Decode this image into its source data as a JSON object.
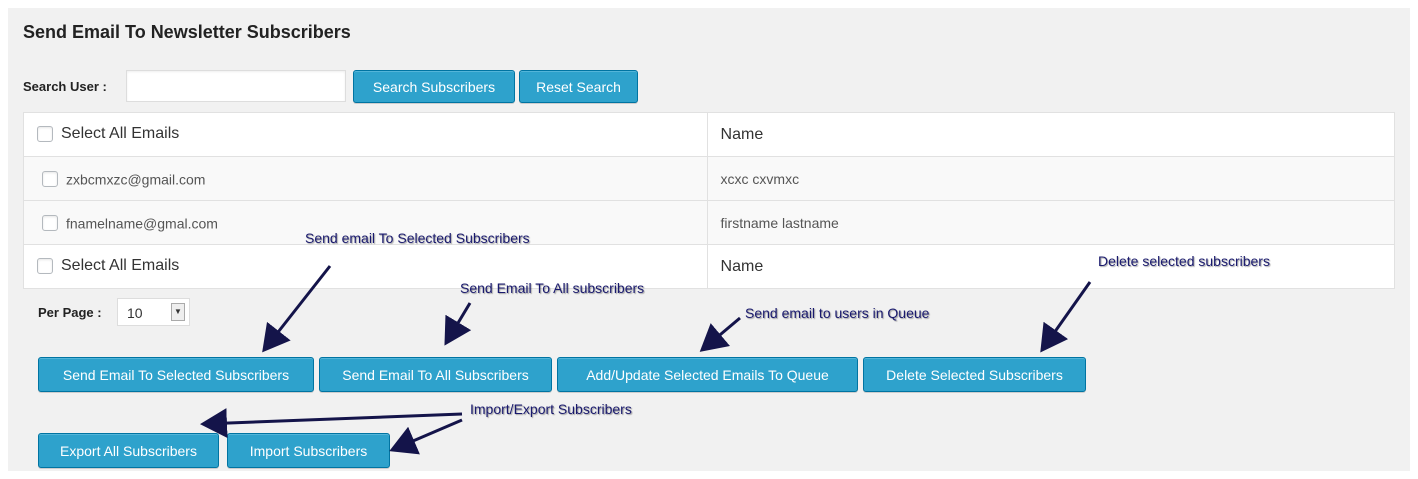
{
  "page": {
    "title": "Send Email To Newsletter Subscribers"
  },
  "search": {
    "label": "Search User :",
    "value": "",
    "placeholder": "",
    "search_button": "Search Subscribers",
    "reset_button": "Reset Search"
  },
  "table": {
    "header": {
      "select_all": "Select All Emails",
      "name": "Name"
    },
    "rows": [
      {
        "email": "zxbcmxzc@gmail.com",
        "name": "xcxc cxvmxc"
      },
      {
        "email": "fnamelname@gmal.com",
        "name": "firstname lastname"
      }
    ],
    "footer": {
      "select_all": "Select All Emails",
      "name": "Name"
    }
  },
  "pagination": {
    "per_page_label": "Per Page :",
    "per_page_value": "10"
  },
  "actions": {
    "send_selected": "Send Email To Selected Subscribers",
    "send_all": "Send Email To All Subscribers",
    "add_queue": "Add/Update Selected Emails To Queue",
    "delete_selected": "Delete Selected Subscribers",
    "export_all": "Export All Subscribers",
    "import": "Import Subscribers"
  },
  "annotations": {
    "send_selected": "Send email To Selected Subscribers",
    "send_all": "Send Email To All subscribers",
    "queue": "Send email to users in Queue",
    "delete": "Delete selected subscribers",
    "import_export": "Import/Export Subscribers"
  },
  "colors": {
    "button_bg": "#2ea2cc",
    "button_border": "#0074a2",
    "annotation_text": "#1a1a6e",
    "arrow": "#14144a"
  }
}
